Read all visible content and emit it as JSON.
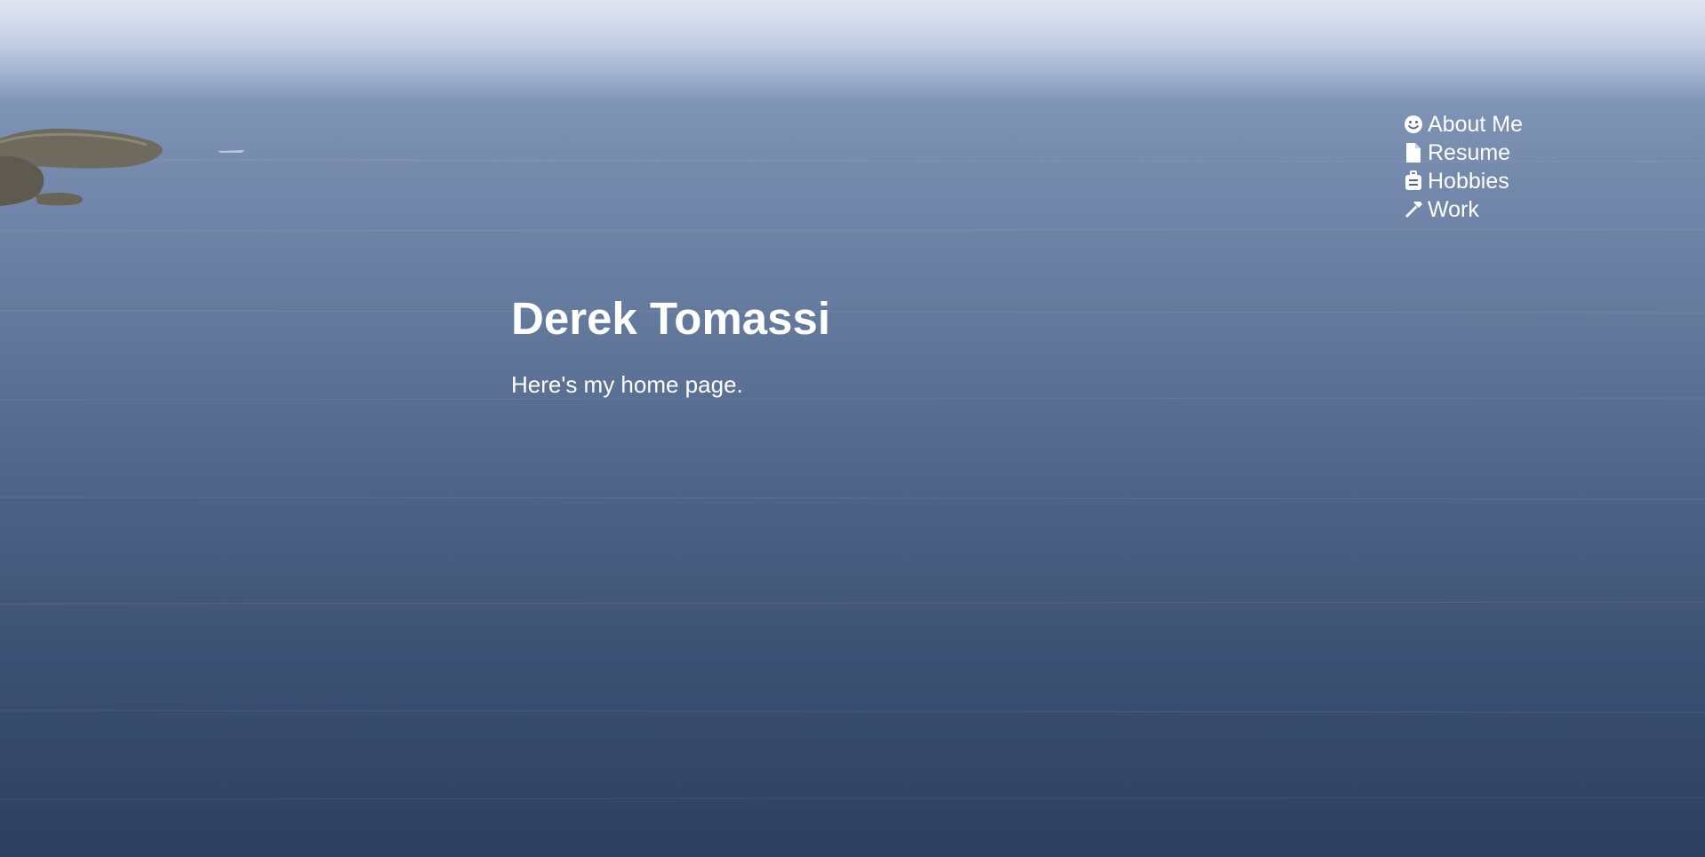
{
  "nav": {
    "items": [
      {
        "label": "About Me",
        "icon": "smile-icon"
      },
      {
        "label": "Resume",
        "icon": "file-icon"
      },
      {
        "label": "Hobbies",
        "icon": "suitcase-icon"
      },
      {
        "label": "Work",
        "icon": "hammer-icon"
      }
    ]
  },
  "hero": {
    "title": "Derek Tomassi",
    "subtitle": "Here's my home page."
  },
  "colors": {
    "text": "#ffffff",
    "sky": "#d3dcee",
    "sea_deep": "#2c3f60"
  }
}
